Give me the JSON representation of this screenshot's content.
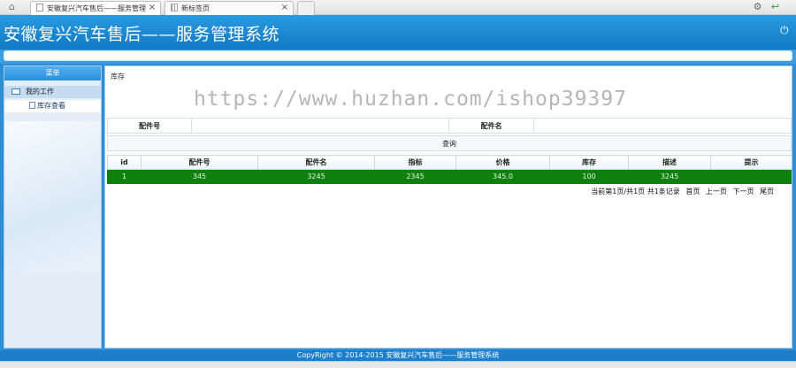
{
  "browser": {
    "tabs": [
      {
        "label": "安徽复兴汽车售后——服务管理",
        "active": true
      },
      {
        "label": "新标签页",
        "active": false
      }
    ],
    "close_glyph": "×"
  },
  "header": {
    "title": "安徽复兴汽车售后——服务管理系统",
    "power_icon": "power-icon"
  },
  "sidebar": {
    "heading": "菜单",
    "group": "我的工作",
    "items": [
      {
        "label": "库存查看"
      }
    ]
  },
  "main": {
    "breadcrumb": "库存",
    "watermark": "https://www.huzhan.com/ishop39397",
    "search": {
      "label1": "配件号",
      "label2": "配件名",
      "query_button": "查询"
    },
    "table": {
      "headers": [
        "id",
        "配件号",
        "配件名",
        "指标",
        "价格",
        "库存",
        "描述",
        "提示"
      ],
      "rows": [
        [
          "1",
          "345",
          "3245",
          "2345",
          "345.0",
          "100",
          "3245",
          ""
        ]
      ]
    },
    "pager": {
      "summary": "当前第1页/共1页  共1条记录",
      "first": "首页",
      "prev": "上一页",
      "next": "下一页",
      "last": "尾页"
    }
  },
  "footer": {
    "copyright": "CopyRight © 2014-2015 安徽复兴汽车售后——服务管理系统"
  },
  "colors": {
    "header_blue": "#1a86d0",
    "row_green": "#0e800e"
  }
}
